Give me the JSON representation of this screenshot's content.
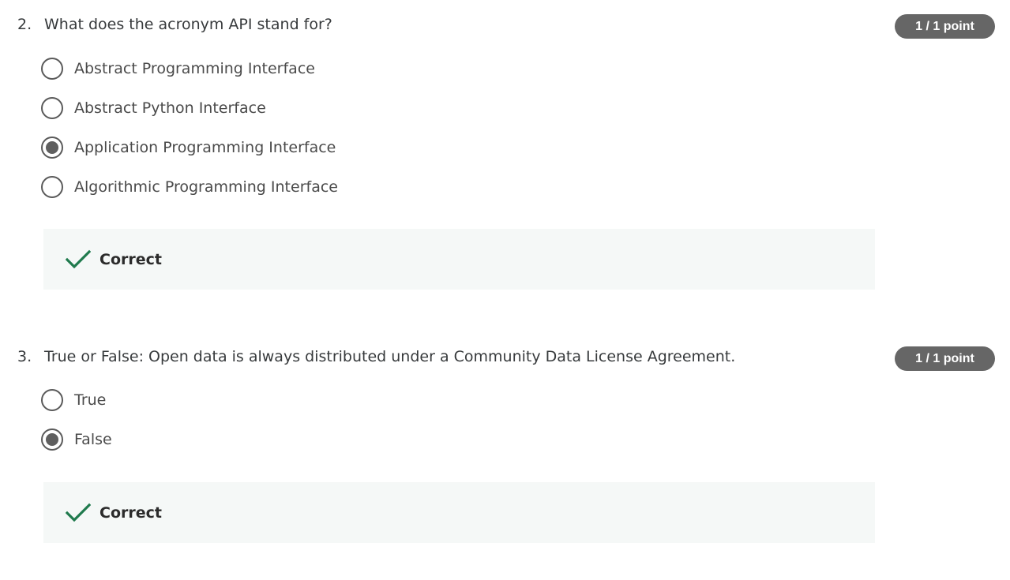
{
  "questions": [
    {
      "number": "2.",
      "text": "What does the acronym API stand for?",
      "points": "1 / 1 point",
      "options": [
        {
          "label": "Abstract Programming Interface",
          "selected": false
        },
        {
          "label": "Abstract Python Interface",
          "selected": false
        },
        {
          "label": "Application Programming Interface",
          "selected": true
        },
        {
          "label": "Algorithmic Programming Interface",
          "selected": false
        }
      ],
      "feedback": {
        "label": "Correct",
        "icon": "checkmark-icon"
      }
    },
    {
      "number": "3.",
      "text": "True or False: Open data is always distributed under a Community Data License Agreement.",
      "points": "1 / 1 point",
      "options": [
        {
          "label": "True",
          "selected": false
        },
        {
          "label": "False",
          "selected": true
        }
      ],
      "feedback": {
        "label": "Correct",
        "icon": "checkmark-icon"
      }
    }
  ],
  "colors": {
    "correct_green": "#1f7a4d",
    "badge_bg": "#666666",
    "feedback_bg": "#f5f8f7"
  }
}
